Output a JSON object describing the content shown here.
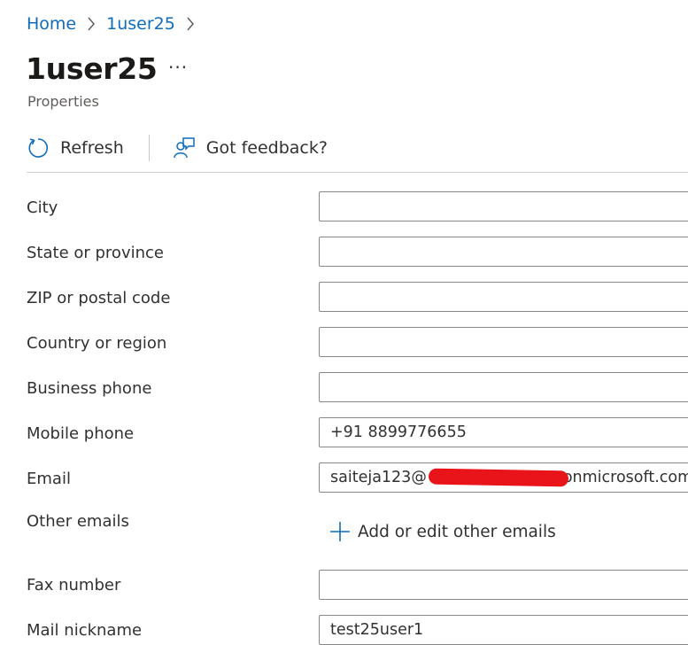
{
  "breadcrumb": {
    "home": "Home",
    "user": "1user25"
  },
  "page": {
    "title": "1user25",
    "more": "···",
    "subtitle": "Properties"
  },
  "toolbar": {
    "refresh": "Refresh",
    "feedback": "Got feedback?"
  },
  "fields": {
    "city": {
      "label": "City",
      "value": ""
    },
    "state": {
      "label": "State or province",
      "value": ""
    },
    "zip": {
      "label": "ZIP or postal code",
      "value": ""
    },
    "country": {
      "label": "Country or region",
      "value": ""
    },
    "business_phone": {
      "label": "Business phone",
      "value": ""
    },
    "mobile_phone": {
      "label": "Mobile phone",
      "value": "+91 8899776655"
    },
    "email": {
      "label": "Email",
      "prefix": "saiteja123@",
      "suffix": "onmicrosoft.com"
    },
    "other_emails": {
      "label": "Other emails",
      "action": "Add or edit other emails"
    },
    "fax": {
      "label": "Fax number",
      "value": ""
    },
    "mail_nickname": {
      "label": "Mail nickname",
      "value": "test25user1"
    }
  },
  "colors": {
    "link": "#0f6cbd",
    "redaction": "#e8141a",
    "border": "#8a8886"
  }
}
